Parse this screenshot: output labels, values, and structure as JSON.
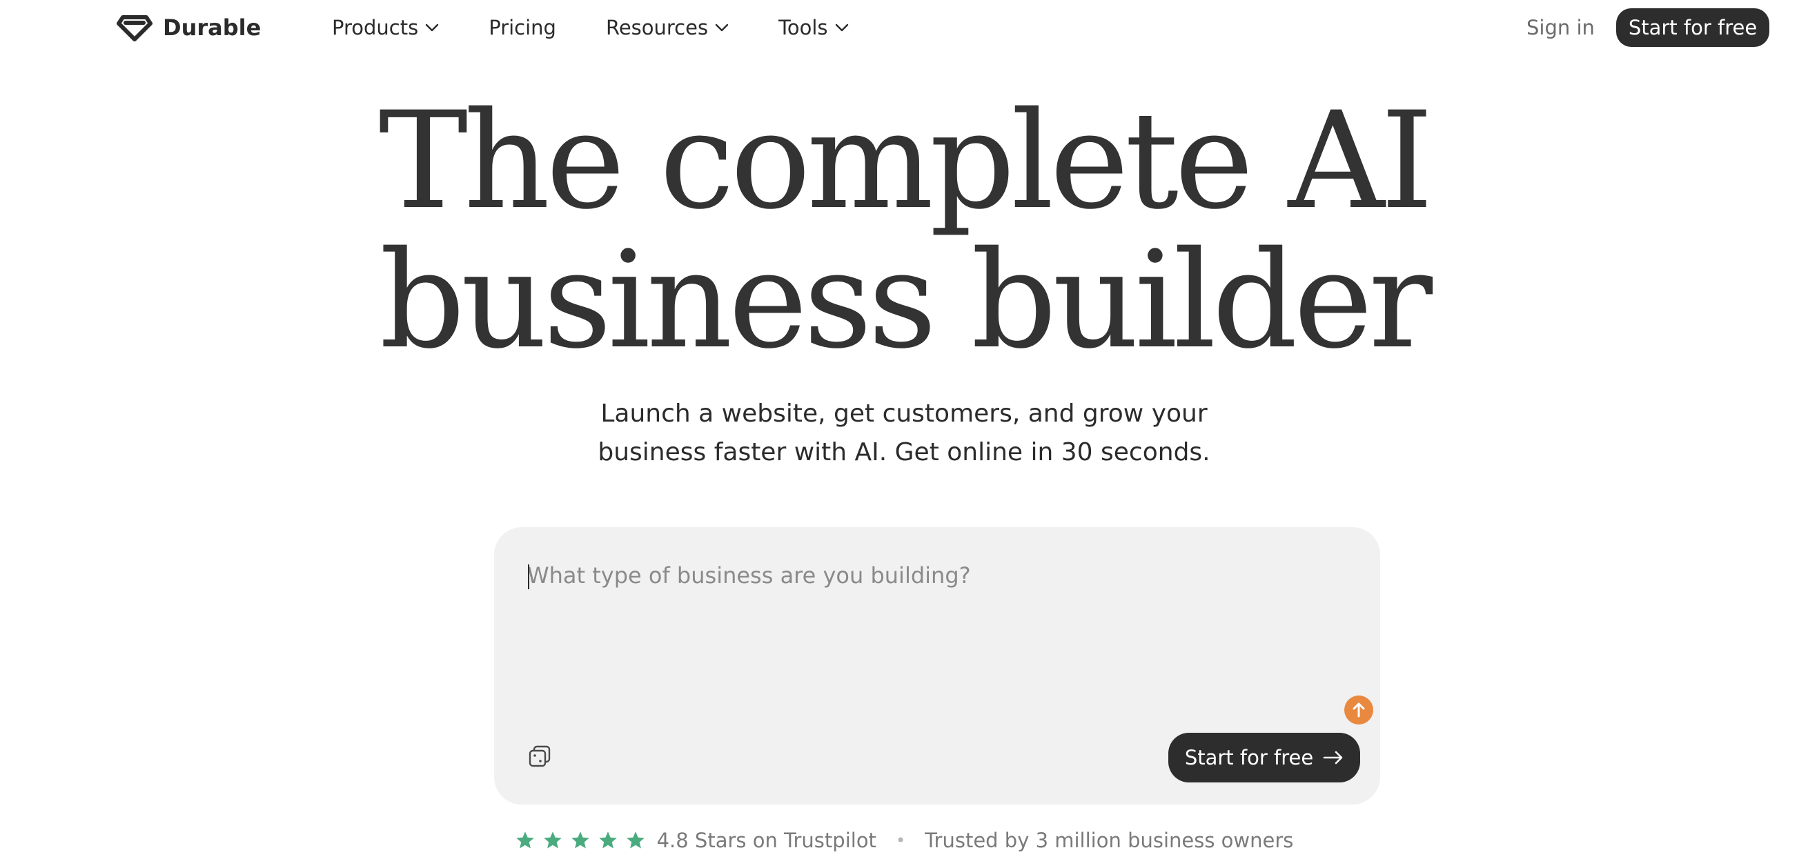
{
  "nav": {
    "brand": "Durable",
    "links": [
      {
        "label": "Products",
        "has_dropdown": true
      },
      {
        "label": "Pricing",
        "has_dropdown": false
      },
      {
        "label": "Resources",
        "has_dropdown": true
      },
      {
        "label": "Tools",
        "has_dropdown": true
      }
    ],
    "signin": "Sign in",
    "cta": "Start for free"
  },
  "hero": {
    "title_line1": "The complete AI",
    "title_line2": "business builder",
    "subtitle_line1": "Launch a website, get customers, and grow your",
    "subtitle_line2": "business faster with AI. Get online in 30 seconds."
  },
  "prompt": {
    "placeholder": "What type of business are you building?",
    "value": "",
    "cta": "Start for free",
    "icons": {
      "shuffle": "dice-icon",
      "upload": "arrow-up-icon",
      "cta_arrow": "arrow-right-icon"
    }
  },
  "trust": {
    "rating_stars": 5,
    "rating_text": "4.8 Stars on Trustpilot",
    "separator": "•",
    "trusted_text": "Trusted by 3 million business owners"
  },
  "colors": {
    "text_dark": "#2e2e2e",
    "button_bg": "#2d2d2d",
    "prompt_bg": "#f1f1f1",
    "accent_orange": "#e8893f",
    "trustpilot_green": "#4aab7f"
  }
}
